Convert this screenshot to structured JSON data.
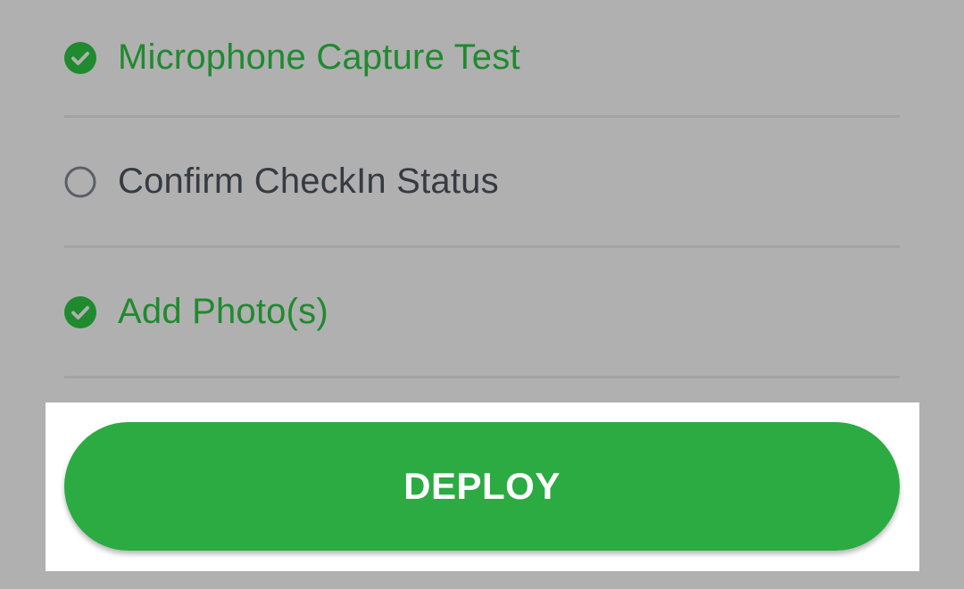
{
  "checklist": {
    "items": [
      {
        "label": "Microphone Capture Test",
        "completed": true,
        "icon": "check-circle-icon"
      },
      {
        "label": "Confirm CheckIn Status",
        "completed": false,
        "icon": "empty-circle-icon"
      },
      {
        "label": "Add Photo(s)",
        "completed": true,
        "icon": "check-circle-icon"
      }
    ]
  },
  "deploy": {
    "label": "DEPLOY",
    "color": "#2bab42",
    "text_color": "#ffffff",
    "highlighted": true
  },
  "colors": {
    "background": "#b0b0b0",
    "completed": "#1f8a2e",
    "pending": "#363b42",
    "divider": "#a3a3a3"
  }
}
